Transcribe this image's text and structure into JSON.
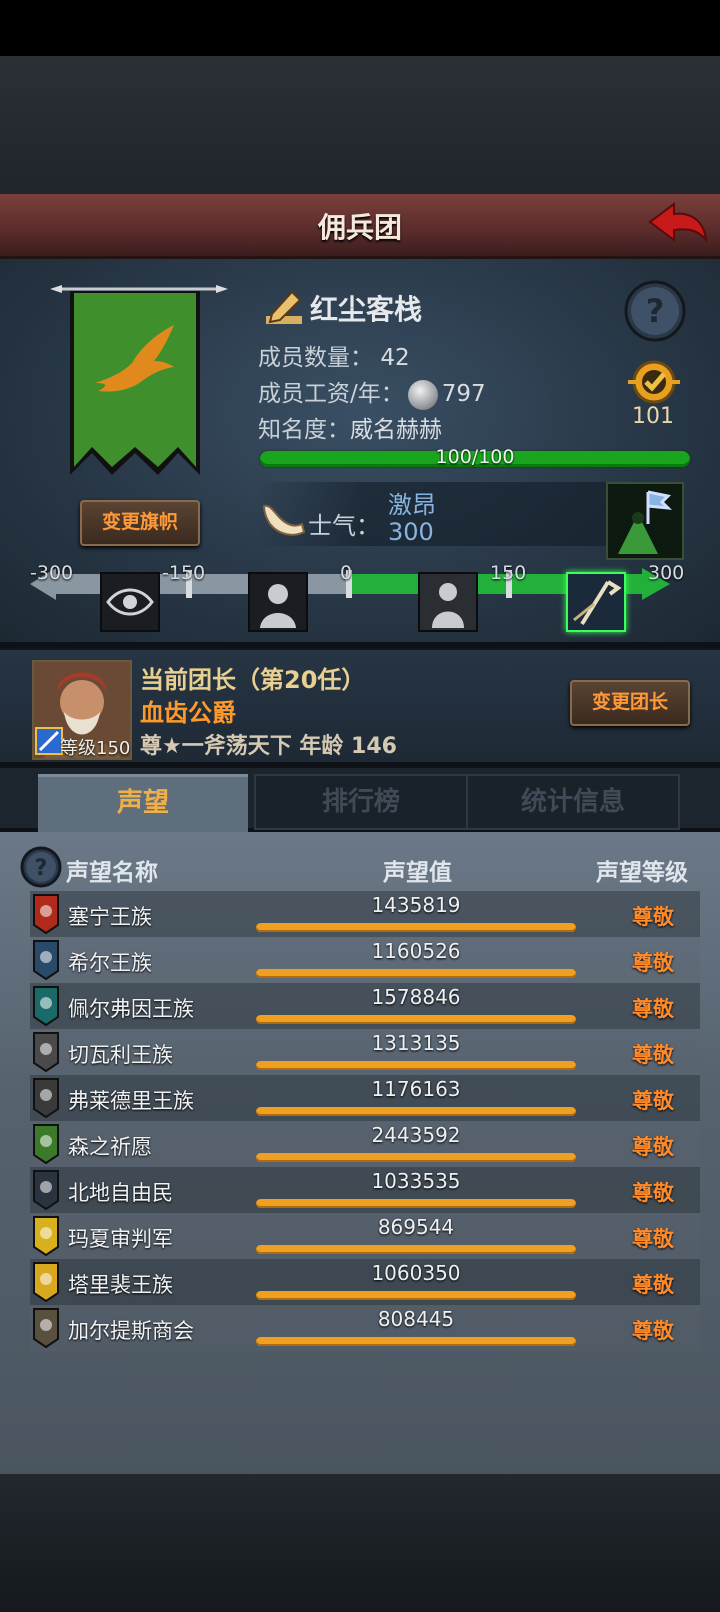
{
  "title": "佣兵团",
  "guild": {
    "name": "红尘客栈",
    "members_label": "成员数量：",
    "members_value": "42",
    "salary_label": "成员工资/年：",
    "salary_value": "797",
    "fame_label": "知名度：",
    "fame_value": "威名赫赫",
    "fame_bar_text": "100/100",
    "fame_progress": 1.0,
    "badge_value": "101",
    "change_banner_label": "变更旗帜",
    "banner_color": "#3f8f2c",
    "emblem_color": "#e08a1e"
  },
  "morale": {
    "label": "士气：",
    "state": "激昂",
    "value": "300",
    "scale": [
      "-300",
      "-150",
      "0",
      "150",
      "300"
    ],
    "current": 300,
    "range": [
      -300,
      300
    ]
  },
  "leader": {
    "title": "当前团长（第20任）",
    "name": "血齿公爵",
    "info": "尊★一斧荡天下  年龄 146",
    "level": "等级150",
    "change_leader_label": "变更团长"
  },
  "tabs": [
    {
      "label": "声望",
      "active": true
    },
    {
      "label": "排行榜",
      "active": false
    },
    {
      "label": "统计信息",
      "active": false
    }
  ],
  "table": {
    "headers": [
      "声望名称",
      "声望值",
      "声望等级"
    ],
    "rows": [
      {
        "name": "塞宁王族",
        "value": "1435819",
        "level": "尊敬",
        "color": "#b02a1c"
      },
      {
        "name": "希尔王族",
        "value": "1160526",
        "level": "尊敬",
        "color": "#2a4a6a"
      },
      {
        "name": "佩尔弗因王族",
        "value": "1578846",
        "level": "尊敬",
        "color": "#1a6a6a"
      },
      {
        "name": "切瓦利王族",
        "value": "1313135",
        "level": "尊敬",
        "color": "#4a4a4a"
      },
      {
        "name": "弗莱德里王族",
        "value": "1176163",
        "level": "尊敬",
        "color": "#3a3a3a"
      },
      {
        "name": "森之祈愿",
        "value": "2443592",
        "level": "尊敬",
        "color": "#3a7a2a"
      },
      {
        "name": "北地自由民",
        "value": "1033535",
        "level": "尊敬",
        "color": "#2a3440"
      },
      {
        "name": "玛夏审判军",
        "value": "869544",
        "level": "尊敬",
        "color": "#d8b01e"
      },
      {
        "name": "塔里裴王族",
        "value": "1060350",
        "level": "尊敬",
        "color": "#d8a81e"
      },
      {
        "name": "加尔提斯商会",
        "value": "808445",
        "level": "尊敬",
        "color": "#5a5040"
      }
    ]
  },
  "icons": [
    "back-arrow-icon",
    "edit-icon",
    "help-icon",
    "coin-icon",
    "badge-icon",
    "horn-icon",
    "morale-banner-icon",
    "eye-icon",
    "sorrow-icon",
    "calm-icon",
    "rally-icon"
  ]
}
